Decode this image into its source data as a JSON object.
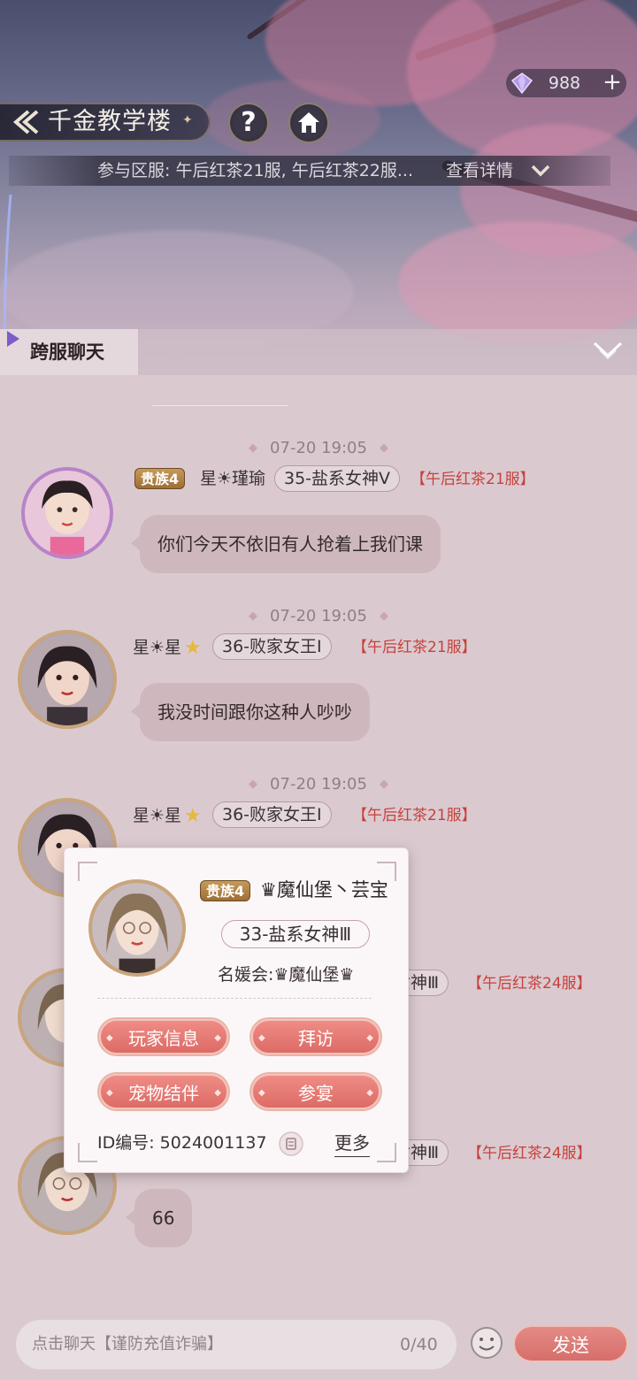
{
  "header": {
    "gem_count": "988",
    "gem_add": "+",
    "title": "千金教学楼",
    "help_label": "?",
    "server_info": "参与区服: 午后红茶21服, 午后红茶22服...",
    "detail_link": "查看详情"
  },
  "chat": {
    "tab_label": "跨服聊天",
    "messages": [
      {
        "time": "07-20 19:05",
        "badge": "贵族4",
        "name": "星☀瑾瑜",
        "title": "35-盐系女神Ⅴ",
        "server": "【午后红茶21服】",
        "text": "你们今天不依旧有人抢着上我们课"
      },
      {
        "time": "07-20 19:05",
        "badge": "",
        "name": "星☀星",
        "title": "36-败家女王Ⅰ",
        "server": "【午后红茶21服】",
        "text": "我没时间跟你这种人吵吵"
      },
      {
        "time": "07-20 19:05",
        "badge": "",
        "name": "星☀星",
        "title": "36-败家女王Ⅰ",
        "server": "【午后红茶21服】",
        "text": ""
      },
      {
        "time": "",
        "badge": "",
        "name": "",
        "title": "系女神Ⅲ",
        "server": "【午后红茶24服】",
        "text": ""
      },
      {
        "time": "",
        "badge": "",
        "name": "",
        "title": "系女神Ⅲ",
        "server": "【午后红茶24服】",
        "text": "66"
      }
    ]
  },
  "popup": {
    "badge": "贵族4",
    "name": "♛魔仙堡丶芸宝",
    "title": "33-盐系女神Ⅲ",
    "club": "名媛会:♛魔仙堡♛",
    "buttons": [
      "玩家信息",
      "拜访",
      "宠物结伴",
      "参宴"
    ],
    "id_text": "ID编号: 5024001137",
    "more": "更多"
  },
  "input": {
    "placeholder": "点击聊天【谨防充值诈骗】",
    "count": "0/40",
    "send": "发送"
  },
  "colors": {
    "accent": "#dd6b66",
    "server_text": "#c7413b",
    "badge": "#b08244"
  }
}
